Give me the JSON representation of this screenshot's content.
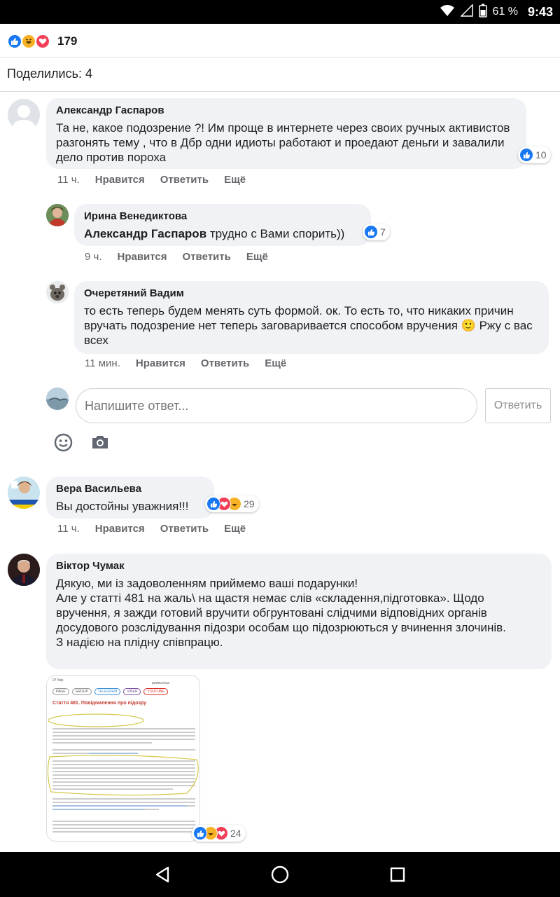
{
  "status_bar": {
    "battery": "61 %",
    "time": "9:43"
  },
  "reactions_summary": {
    "count": "179",
    "icons": [
      "like-icon",
      "haha-icon",
      "love-icon"
    ]
  },
  "shares": {
    "label": "Поделились: 4"
  },
  "actions": {
    "like": "Нравится",
    "reply": "Ответить",
    "more": "Ещё"
  },
  "comments": [
    {
      "author": "Александр Гаспаров",
      "text": "Та не, какое подозрение ?! Им проще в интернете через своих ручных активистов разгонять тему , что в Дбр одни идиоты работают и проедают деньги и завалили дело против пороха",
      "time": "11 ч.",
      "reaction_count": "10"
    },
    {
      "author": "Ирина Венедиктова",
      "mention": "Александр Гаспаров",
      "text": " трудно с Вами спорить))",
      "time": "9 ч.",
      "reaction_count": "7"
    },
    {
      "author": "Очеретяний Вадим",
      "text_before": "то есть теперь будем менять суть формой. ок. То есть то, что никаких причин вручать подозрение нет теперь заговаривается способом вручения ",
      "emoji": "🙂",
      "text_after": " Ржу с вас всех",
      "time": "11 мин."
    },
    {
      "author": "Вера Васильева",
      "text": "Вы достойны уважния!!!",
      "time": "11 ч.",
      "reaction_count": "29"
    },
    {
      "author": "Віктор Чумак",
      "lines": [
        "Дякую, ми із задоволенням приймемо ваші подарунки!",
        "Але у статті 481 на жаль\\ на щастя немає слів «складення,підготовка». Щодо вручення, я зажди готовий вручити обгрунтовані слідчими відповідних органів досудового розслідування підозри особам що підозрюються у вчинення злочинів.",
        "З надією на плідну співпрацю."
      ],
      "attachment_reaction_count": "24"
    }
  ],
  "reply_box": {
    "placeholder": "Напишите ответ...",
    "send_label": "Ответить"
  },
  "attachment": {
    "time": "07 бер.",
    "site": "protocol.ua",
    "tags": [
      "PAGE",
      "GROUP",
      "TELEGRAM",
      "VIBER",
      "YOUTUBE"
    ],
    "title": "Стаття 481. Повідомлення про підозру"
  },
  "colors": {
    "like": "#1877f2",
    "haha": "#f7b125",
    "love": "#f33e58",
    "bubble": "#f0f2f5",
    "meta": "#65676b"
  }
}
